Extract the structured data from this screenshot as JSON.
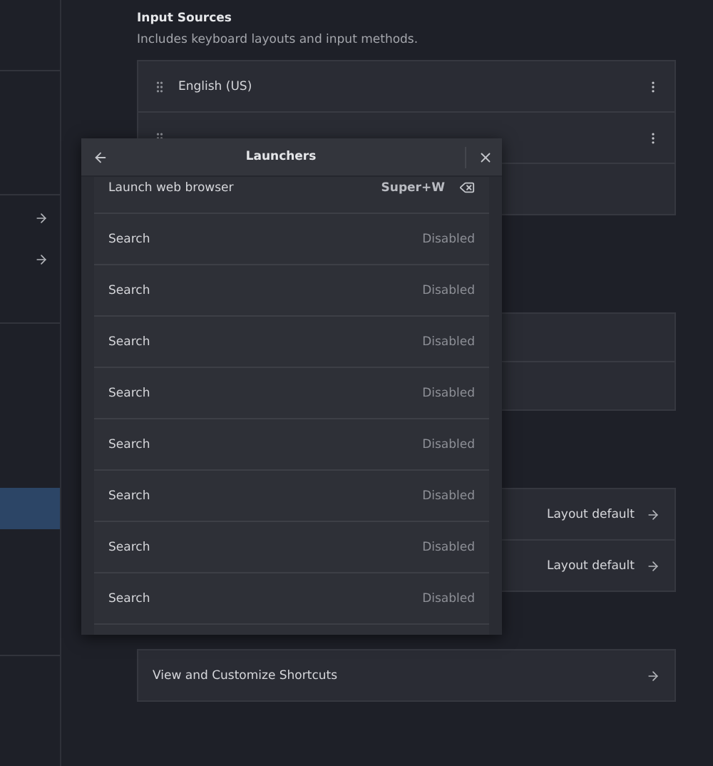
{
  "sidebar": {
    "items": [
      {
        "kind": "link",
        "selected": false
      },
      {
        "kind": "link",
        "selected": false
      },
      {
        "kind": "plain",
        "selected": true
      }
    ]
  },
  "input_sources": {
    "title": "Input Sources",
    "subtitle": "Includes keyboard layouts and input methods.",
    "rows": [
      {
        "kind": "source",
        "name": "English (US)"
      },
      {
        "kind": "source"
      },
      {
        "kind": "blank"
      }
    ]
  },
  "section_2": {
    "rows": [
      {
        "kind": "blank"
      },
      {
        "kind": "blank"
      }
    ]
  },
  "section_3": {
    "rows": [
      {
        "kind": "value",
        "value": "Layout default"
      },
      {
        "kind": "value",
        "value": "Layout default"
      }
    ]
  },
  "shortcuts": {
    "label": "View and Customize Shortcuts"
  },
  "dialog": {
    "title": "Launchers",
    "rows": [
      {
        "kind": "assigned",
        "name": "Launch web browser",
        "shortcut": "Super+W"
      },
      {
        "kind": "disabled",
        "name": "Search",
        "shortcut": "Disabled"
      },
      {
        "kind": "disabled",
        "name": "Search",
        "shortcut": "Disabled"
      },
      {
        "kind": "disabled",
        "name": "Search",
        "shortcut": "Disabled"
      },
      {
        "kind": "disabled",
        "name": "Search",
        "shortcut": "Disabled"
      },
      {
        "kind": "disabled",
        "name": "Search",
        "shortcut": "Disabled"
      },
      {
        "kind": "disabled",
        "name": "Search",
        "shortcut": "Disabled"
      },
      {
        "kind": "disabled",
        "name": "Search",
        "shortcut": "Disabled"
      },
      {
        "kind": "disabled",
        "name": "Search",
        "shortcut": "Disabled"
      },
      {
        "kind": "partial"
      }
    ]
  }
}
